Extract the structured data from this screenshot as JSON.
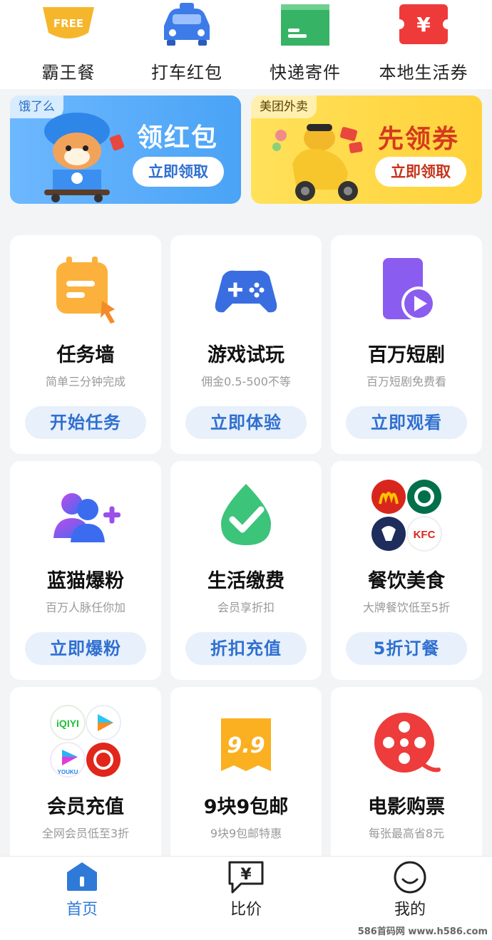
{
  "quick_links": [
    {
      "label": "霸王餐",
      "badge": "FREE",
      "icon": "free-meal-icon"
    },
    {
      "label": "打车红包",
      "icon": "taxi-icon"
    },
    {
      "label": "快递寄件",
      "icon": "package-icon"
    },
    {
      "label": "本地生活券",
      "badge": "¥",
      "icon": "coupon-icon"
    }
  ],
  "banners": [
    {
      "tag": "饿了么",
      "title": "领红包",
      "button": "立即领取"
    },
    {
      "tag": "美团外卖",
      "title": "先领券",
      "button": "立即领取"
    }
  ],
  "cards": [
    {
      "title": "任务墙",
      "subtitle": "简单三分钟完成",
      "button": "开始任务",
      "icon": "task-board-icon"
    },
    {
      "title": "游戏试玩",
      "subtitle": "佣金0.5-500不等",
      "button": "立即体验",
      "icon": "gamepad-icon"
    },
    {
      "title": "百万短剧",
      "subtitle": "百万短剧免费看",
      "button": "立即观看",
      "icon": "play-phone-icon"
    },
    {
      "title": "蓝猫爆粉",
      "subtitle": "百万人脉任你加",
      "button": "立即爆粉",
      "icon": "add-people-icon"
    },
    {
      "title": "生活缴费",
      "subtitle": "会员享折扣",
      "button": "折扣充值",
      "icon": "water-drop-check-icon"
    },
    {
      "title": "餐饮美食",
      "subtitle": "大牌餐饮低至5折",
      "button": "5折订餐",
      "icon": "restaurant-brands-icon",
      "brand_text": "KFC"
    },
    {
      "title": "会员充值",
      "subtitle": "全网会员低至3折",
      "button": "",
      "icon": "video-vip-brands-icon",
      "brand_text": [
        "iQIYI",
        "YOUKU"
      ]
    },
    {
      "title": "9块9包邮",
      "subtitle": "9块9包邮特惠",
      "button": "",
      "icon": "nine-nine-icon",
      "badge": "9.9"
    },
    {
      "title": "电影购票",
      "subtitle": "每张最高省8元",
      "button": "",
      "icon": "film-reel-icon"
    }
  ],
  "tabs": [
    {
      "label": "首页",
      "icon": "home-icon",
      "active": true
    },
    {
      "label": "比价",
      "icon": "price-compare-icon",
      "badge": "¥",
      "active": false
    },
    {
      "label": "我的",
      "icon": "profile-smile-icon",
      "active": false
    }
  ],
  "watermark": "586首码网 www.h586.com",
  "colors": {
    "accent": "#2f6fd0",
    "tab_active": "#2f7ad8",
    "background": "#f3f4f6"
  }
}
